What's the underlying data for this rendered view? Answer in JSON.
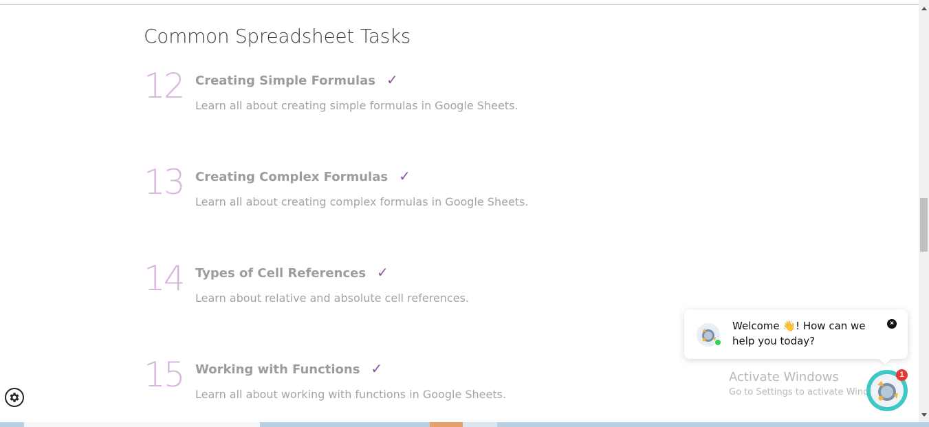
{
  "section": {
    "title": "Common Spreadsheet Tasks"
  },
  "lessons": [
    {
      "number": "12",
      "title": "Creating Simple Formulas",
      "check": "✓",
      "description": "Learn all about creating simple formulas in Google Sheets."
    },
    {
      "number": "13",
      "title": "Creating Complex Formulas",
      "check": "✓",
      "description": "Learn all about creating complex formulas in Google Sheets."
    },
    {
      "number": "14",
      "title": "Types of Cell References",
      "check": "✓",
      "description": "Learn about relative and absolute cell references."
    },
    {
      "number": "15",
      "title": "Working with Functions",
      "check": "✓",
      "description": "Learn all about working with functions in Google Sheets."
    }
  ],
  "chat": {
    "message": "Welcome 👋! How can we help you today?",
    "close_icon": "×",
    "badge_count": "1",
    "online_color": "#2fd34b",
    "launcher_color": "#3ec7c3"
  },
  "watermark": {
    "title": "Activate Windows",
    "subtitle": "Go to Settings to activate Windows."
  },
  "colors": {
    "accent_check": "#8c4fa0",
    "lesson_number": "#d9b6df"
  }
}
